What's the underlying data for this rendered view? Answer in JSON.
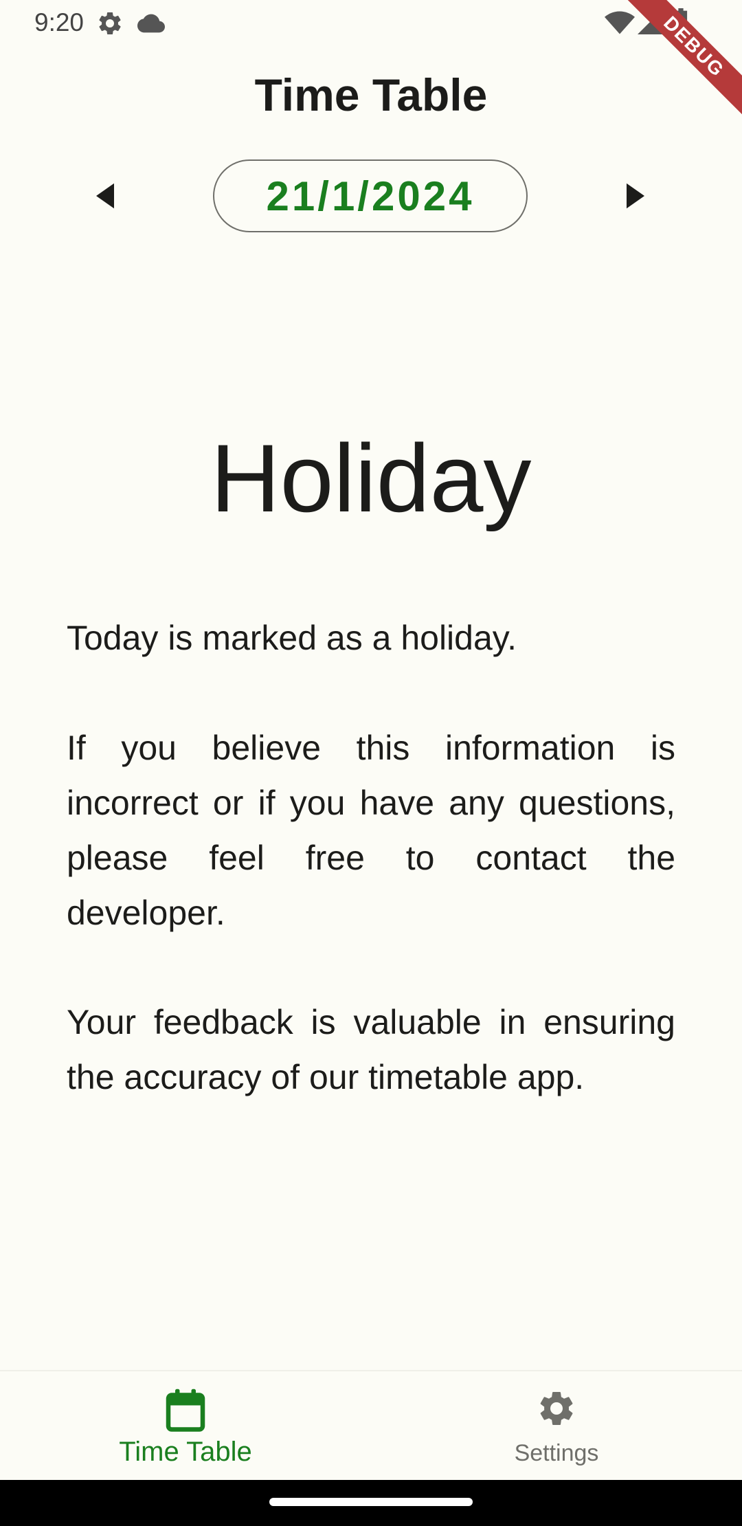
{
  "status_bar": {
    "time": "9:20",
    "icons": [
      "settings-icon",
      "cloud-icon",
      "wifi-icon",
      "signal-icon",
      "battery-icon"
    ]
  },
  "debug_banner": "DEBUG",
  "header": {
    "title": "Time Table"
  },
  "date_nav": {
    "date": "21/1/2024",
    "prev_icon": "arrow-left-icon",
    "next_icon": "arrow-right-icon"
  },
  "holiday": {
    "heading": "Holiday",
    "messages": [
      "Today is marked as a holiday.",
      "If you believe this information is incorrect or if you have any questions, please feel free to contact the developer.",
      "Your feedback is valuable in ensuring the accuracy of our timetable app."
    ]
  },
  "bottom_nav": {
    "items": [
      {
        "label": "Time Table",
        "icon": "calendar-icon",
        "active": true
      },
      {
        "label": "Settings",
        "icon": "gear-icon",
        "active": false
      }
    ]
  },
  "colors": {
    "accent": "#1a7f1f",
    "background": "#fcfcf6",
    "text": "#1c1c1a",
    "muted": "#6f6f6a",
    "debug": "#b53a3a"
  }
}
